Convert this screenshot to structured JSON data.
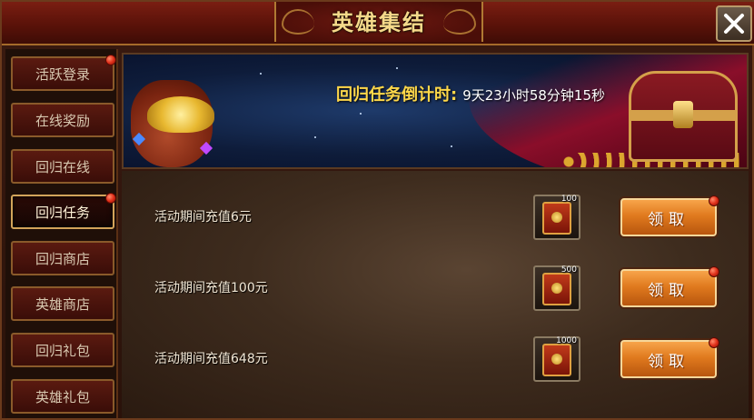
{
  "window": {
    "title": "英雄集结"
  },
  "sidebar": {
    "items": [
      {
        "label": "活跃登录",
        "badge": true,
        "active": false
      },
      {
        "label": "在线奖励",
        "badge": false,
        "active": false
      },
      {
        "label": "回归在线",
        "badge": false,
        "active": false
      },
      {
        "label": "回归任务",
        "badge": true,
        "active": true
      },
      {
        "label": "回归商店",
        "badge": false,
        "active": false
      },
      {
        "label": "英雄商店",
        "badge": false,
        "active": false
      },
      {
        "label": "回归礼包",
        "badge": false,
        "active": false
      },
      {
        "label": "英雄礼包",
        "badge": false,
        "active": false
      }
    ]
  },
  "banner": {
    "countdown_label": "回归任务倒计时:",
    "countdown_value": "9天23小时58分钟15秒"
  },
  "tasks": [
    {
      "description": "活动期间充值6元",
      "reward_count": "100",
      "button_label": "领取",
      "badge": true
    },
    {
      "description": "活动期间充值100元",
      "reward_count": "500",
      "button_label": "领取",
      "badge": true
    },
    {
      "description": "活动期间充值648元",
      "reward_count": "1000",
      "button_label": "领取",
      "badge": true
    }
  ],
  "icons": {
    "close": "close-icon",
    "reward_item": "scroll-item-icon",
    "notification": "red-dot-icon"
  },
  "colors": {
    "title_text": "#f5d98a",
    "countdown_label": "#ffd84a",
    "claim_button": "#e07a1e",
    "notification_dot": "#e0301a",
    "active_tab_border": "#d2a45a"
  }
}
